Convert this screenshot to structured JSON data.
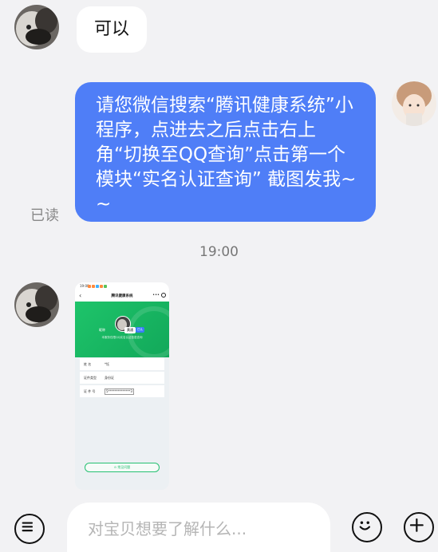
{
  "messages": {
    "incoming_1": {
      "text": "可以"
    },
    "outgoing_1": {
      "text": "请您微信搜索“腾讯健康系统”小程序，点进去之后点击右上角“切换至QQ查询”点击第一个模块“实名认证查询” 截图发我~~",
      "status": "已读"
    },
    "time_divider": "19:00"
  },
  "screenshot_card": {
    "status_time": "19:00",
    "nav_title": "腾讯健康系统",
    "nav_more": "•••",
    "nickname_label": "昵称",
    "verified_name": "黄通",
    "verified_tag": "已认",
    "description": "本服务仅限QQ实名认证信息查询",
    "rows": [
      {
        "key": "姓    名",
        "value": "*钰"
      },
      {
        "key": "证件类型",
        "value": "身份证"
      },
      {
        "key": "证 件 号",
        "value": "5**************3"
      }
    ],
    "bottom_button": "⊙ 常见问题"
  },
  "input_bar": {
    "placeholder": "对宝贝想要了解什么...",
    "left_icon": "menu-lines-icon",
    "emoji_icon": "smiley-icon",
    "add_icon": "plus-icon"
  },
  "colors": {
    "background": "#f2f2f4",
    "outgoing_bubble": "#4f7ef7",
    "incoming_bubble": "#ffffff",
    "mini_program_green": "#1ec46a"
  }
}
